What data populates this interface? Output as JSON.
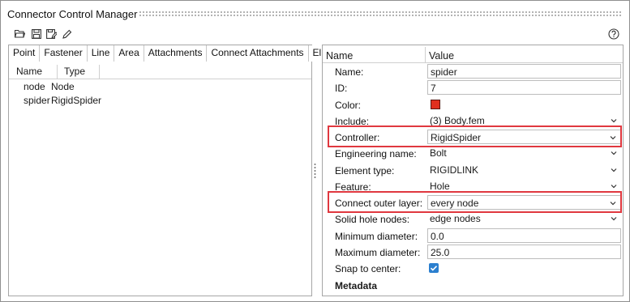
{
  "window": {
    "title": "Connector Control Manager"
  },
  "toolbar": {
    "icons": [
      "open-folder-icon",
      "save-icon",
      "save-as-icon",
      "edit-pencil-icon"
    ],
    "help_icon": "help-icon"
  },
  "left_panel": {
    "tabs": [
      "Point",
      "Fastener",
      "Line",
      "Area",
      "Attachments",
      "Connect Attachments",
      "Eline"
    ],
    "columns": {
      "name": "Name",
      "type": "Type"
    },
    "rows": [
      {
        "name": "node",
        "type": "Node"
      },
      {
        "name": "spider",
        "type": "RigidSpider"
      }
    ]
  },
  "right_panel": {
    "columns": {
      "name": "Name",
      "value": "Value"
    },
    "properties": [
      {
        "label": "Name:",
        "value": "spider",
        "kind": "text"
      },
      {
        "label": "ID:",
        "value": "7",
        "kind": "text"
      },
      {
        "label": "Color:",
        "value": "#e1301e",
        "kind": "color"
      },
      {
        "label": "Include:",
        "value": "(3) Body.fem",
        "kind": "select"
      },
      {
        "label": "Controller:",
        "value": "RigidSpider",
        "kind": "select",
        "highlighted": true
      },
      {
        "label": "Engineering name:",
        "value": "Bolt",
        "kind": "select"
      },
      {
        "label": "Element type:",
        "value": "RIGIDLINK",
        "kind": "select"
      },
      {
        "label": "Feature:",
        "value": "Hole",
        "kind": "select"
      },
      {
        "label": "Connect outer layer:",
        "value": "every node",
        "kind": "select",
        "highlighted": true
      },
      {
        "label": "Solid hole nodes:",
        "value": "edge nodes",
        "kind": "select"
      },
      {
        "label": "Minimum diameter:",
        "value": "0.0",
        "kind": "text"
      },
      {
        "label": "Maximum diameter:",
        "value": "25.0",
        "kind": "text"
      },
      {
        "label": "Snap to center:",
        "value": "checked",
        "kind": "checkbox"
      }
    ],
    "metadata_label": "Metadata"
  },
  "colors": {
    "highlight": "#e0383f",
    "checkbox": "#2b7fcf"
  }
}
